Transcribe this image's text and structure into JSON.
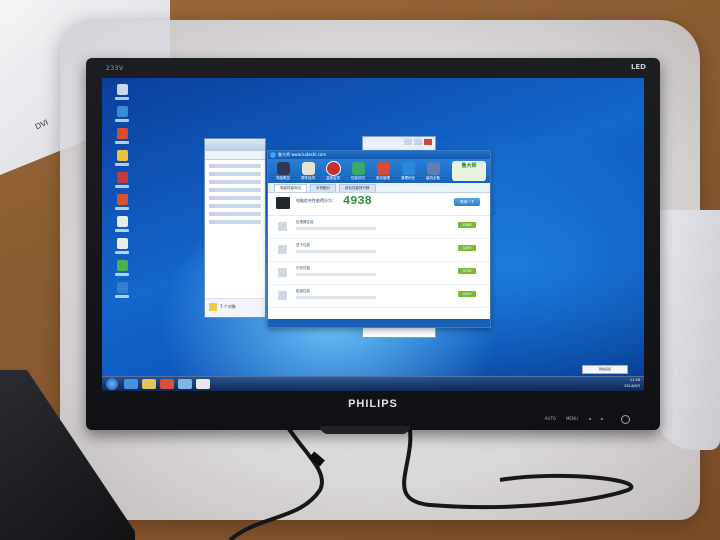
{
  "scene": {
    "description_free": true,
    "paper_label": "DVI"
  },
  "monitor": {
    "model": "233V",
    "panel_type": "LED",
    "brand": "PHILIPS",
    "bottom_controls": [
      "AUTO",
      "MENU",
      "◄",
      "►"
    ]
  },
  "desktop": {
    "icon_count": 10
  },
  "app": {
    "title": "鲁大师 www.ludashi.com",
    "toolbar": [
      {
        "label": "电脑概览",
        "icon": "overview-icon"
      },
      {
        "label": "硬件检测",
        "icon": "hardware-icon"
      },
      {
        "label": "温度监测",
        "icon": "temperature-icon"
      },
      {
        "label": "性能测试",
        "icon": "performance-icon"
      },
      {
        "label": "驱动管理",
        "icon": "driver-icon"
      },
      {
        "label": "清理优化",
        "icon": "clean-icon"
      },
      {
        "label": "装机必备",
        "icon": "software-icon"
      },
      {
        "label": "游戏库",
        "icon": "game-icon"
      }
    ],
    "mascot_text": "鲁大师",
    "tabs": [
      "电脑性能测试",
      "手机跑分",
      "综合性能排行榜"
    ],
    "score": {
      "label": "电脑综合性能得分为：",
      "value": "4938",
      "button": "再测一下"
    },
    "metrics": [
      {
        "name": "处理器性能",
        "score": "4568"
      },
      {
        "name": "显卡性能",
        "score": "3283"
      },
      {
        "name": "内存性能",
        "score": "3726"
      },
      {
        "name": "磁盘性能",
        "score": "3059"
      }
    ]
  },
  "explorer": {
    "status_text": "7 个对象"
  },
  "taskbar": {
    "time": "11:28",
    "date": "2014/6/3"
  },
  "tray_popup": "网络连接",
  "colors": {
    "screen_blue": "#1366cc",
    "score_green": "#2e8b3d",
    "metric_badge": "#79b935",
    "app_blue": "#1f6fc9"
  }
}
